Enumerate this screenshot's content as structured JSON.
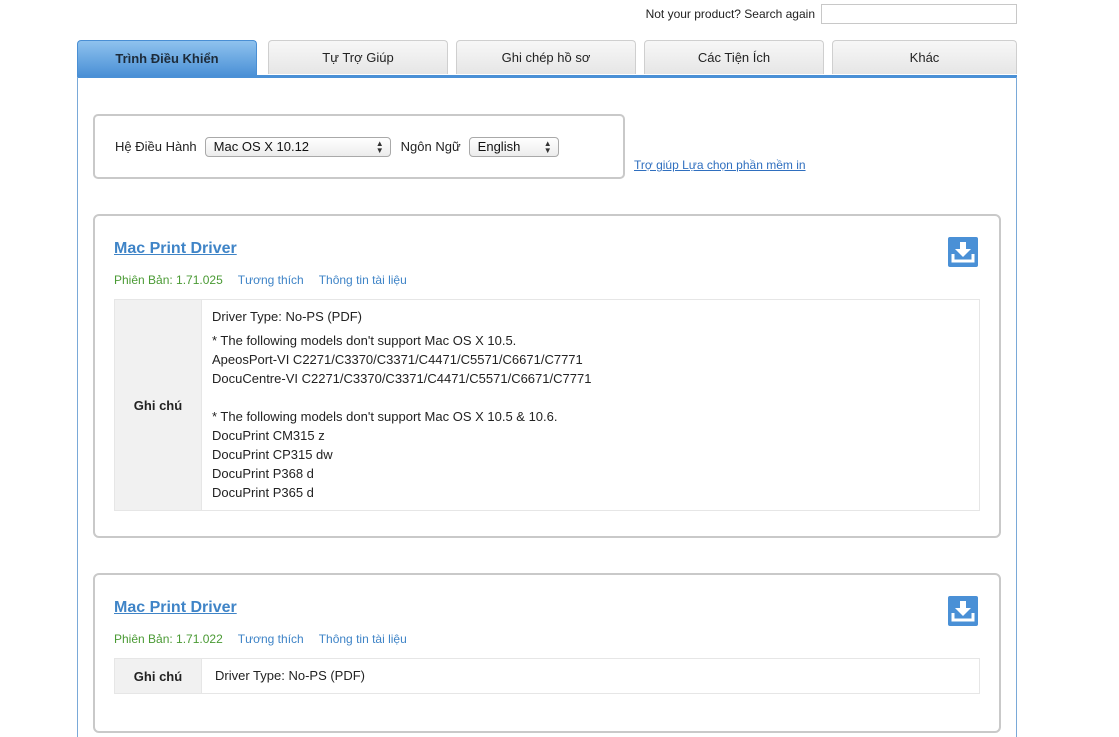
{
  "search": {
    "label": "Not your product? Search again",
    "value": ""
  },
  "tabs": [
    {
      "label": "Trình Điều Khiển",
      "active": true
    },
    {
      "label": "Tự Trợ Giúp",
      "active": false
    },
    {
      "label": "Ghi chép hồ sơ",
      "active": false
    },
    {
      "label": "Các Tiện Ích",
      "active": false
    },
    {
      "label": "Khác",
      "active": false
    }
  ],
  "filters": {
    "os_label": "Hệ Điều Hành",
    "os_value": "Mac OS X 10.12",
    "lang_label": "Ngôn Ngữ",
    "lang_value": "English",
    "help_link": "Trợ giúp Lựa chọn phần mềm in"
  },
  "drivers": [
    {
      "title": "Mac Print Driver",
      "version": "Phiên Bản: 1.71.025",
      "compat_link": "Tương thích",
      "docs_link": "Thông tin tài liệu",
      "notes_label": "Ghi chú",
      "notes": {
        "driver_type": "Driver Type: No-PS (PDF)",
        "group1_header": "* The following models don't support Mac OS X 10.5.",
        "group1_line1": "ApeosPort-VI C2271/C3370/C3371/C4471/C5571/C6671/C7771",
        "group1_line2": "DocuCentre-VI C2271/C3370/C3371/C4471/C5571/C6671/C7771",
        "group2_header": "* The following models don't support Mac OS X 10.5 & 10.6.",
        "group2_line1": "DocuPrint CM315 z",
        "group2_line2": "DocuPrint CP315 dw",
        "group2_line3": "DocuPrint P368 d",
        "group2_line4": "DocuPrint P365 d"
      }
    },
    {
      "title": "Mac Print Driver",
      "version": "Phiên Bản: 1.71.022",
      "compat_link": "Tương thích",
      "docs_link": "Thông tin tài liệu",
      "notes_label": "Ghi chú",
      "notes": {
        "driver_type": "Driver Type: No-PS (PDF)"
      }
    }
  ],
  "colors": {
    "accent": "#4a90d6",
    "link": "#3f84c7",
    "version": "#4a9a34"
  },
  "icons": {
    "download": "download-icon"
  }
}
